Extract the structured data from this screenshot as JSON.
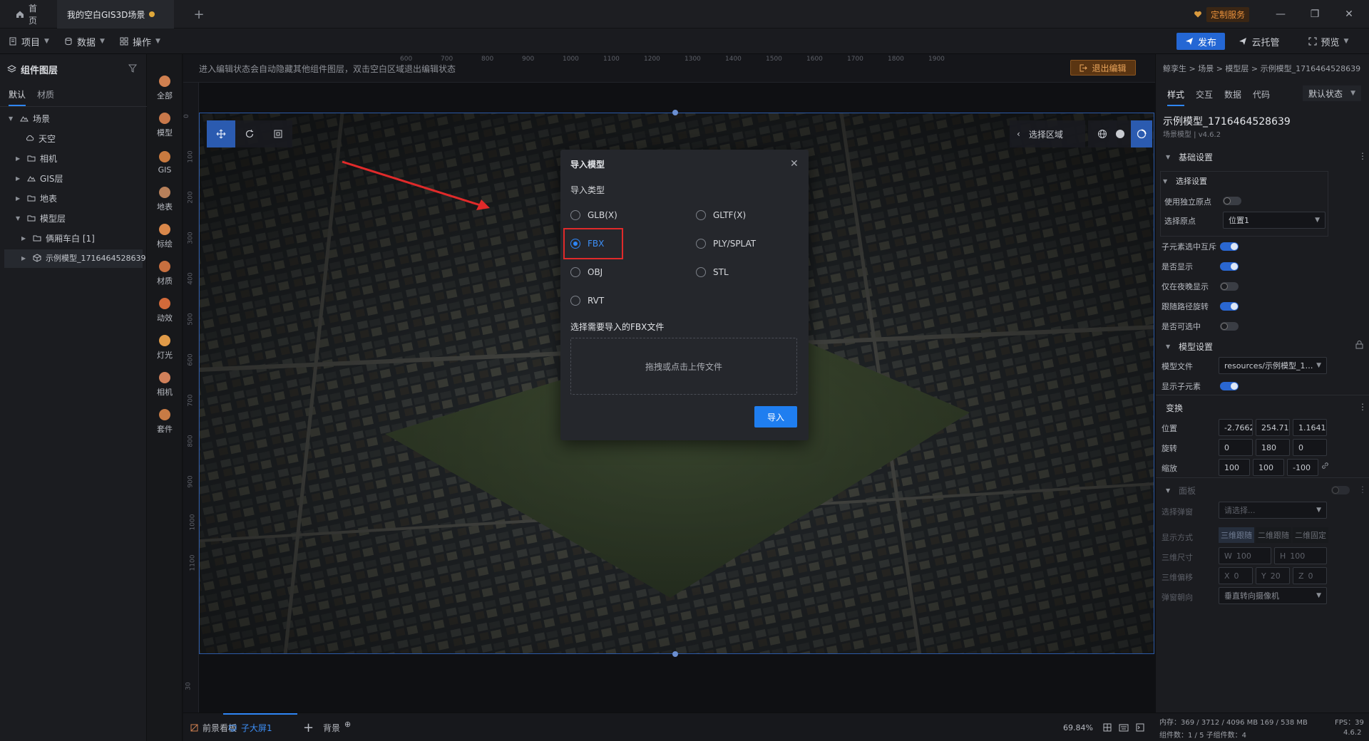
{
  "tabs": [
    {
      "label": "首页"
    },
    {
      "label": "我的空白GIS3D场景"
    }
  ],
  "titlebar": {
    "custom_service": "定制服务"
  },
  "menubar": {
    "project": "项目",
    "data": "数据",
    "operate": "操作",
    "publish": "发布",
    "cloud_host": "云托管",
    "preview": "预览"
  },
  "left": {
    "title": "组件图层",
    "tabs": [
      "默认",
      "材质"
    ],
    "tree": [
      {
        "label": "场景"
      },
      {
        "label": "天空"
      },
      {
        "label": "相机"
      },
      {
        "label": "GIS层"
      },
      {
        "label": "地表"
      },
      {
        "label": "模型层"
      },
      {
        "label": "俩厢车白 [1]"
      },
      {
        "label": "示例模型_1716464528639"
      }
    ]
  },
  "iconbar": [
    {
      "label": "全部",
      "color": "#d08050"
    },
    {
      "label": "模型",
      "color": "#c8784a"
    },
    {
      "label": "GIS",
      "color": "#c97a3f"
    },
    {
      "label": "地表",
      "color": "#b8805a"
    },
    {
      "label": "标绘",
      "color": "#d9874a"
    },
    {
      "label": "材质",
      "color": "#c76f3f"
    },
    {
      "label": "动效",
      "color": "#d36a3a"
    },
    {
      "label": "灯光",
      "color": "#e09a48"
    },
    {
      "label": "相机",
      "color": "#d0805a"
    },
    {
      "label": "套件",
      "color": "#c77b45"
    }
  ],
  "canvas": {
    "hint": "进入编辑状态会自动隐藏其他组件图层，双击空白区域退出编辑状态",
    "exit_edit": "退出编辑",
    "select_area": "选择区域",
    "ruler_top": [
      "600",
      "700",
      "800",
      "900",
      "1000",
      "1100",
      "1200",
      "1300",
      "1400",
      "1500",
      "1600",
      "1700",
      "1800",
      "1900"
    ],
    "ruler_left": [
      "0",
      "100",
      "200",
      "300",
      "400",
      "500",
      "600",
      "700",
      "800",
      "900",
      "1000",
      "1100",
      "30"
    ]
  },
  "modal": {
    "title": "导入模型",
    "type_label": "导入类型",
    "options": [
      {
        "label": "GLB(X)",
        "selected": false
      },
      {
        "label": "GLTF(X)",
        "selected": false
      },
      {
        "label": "FBX",
        "selected": true
      },
      {
        "label": "PLY/SPLAT",
        "selected": false
      },
      {
        "label": "OBJ",
        "selected": false
      },
      {
        "label": "STL",
        "selected": false
      },
      {
        "label": "RVT",
        "selected": false
      }
    ],
    "file_label": "选择需要导入的FBX文件",
    "upload_hint": "拖拽或点击上传文件",
    "import_btn": "导入"
  },
  "right": {
    "breadcrumb": "鲸孪生 > 场景 > 模型层 > 示例模型_1716464528639",
    "tabs": [
      "样式",
      "交互",
      "数据",
      "代码"
    ],
    "state_select": "默认状态",
    "name": "示例模型_1716464528639",
    "subtitle": "场景模型 | v4.6.2",
    "basic_settings": "基础设置",
    "select_settings": "选择设置",
    "use_independent_origin": "使用独立原点",
    "select_origin": "选择原点",
    "origin_value": "位置1",
    "child_exclusive": "子元素选中互斥",
    "is_visible": "是否显示",
    "night_only": "仅在夜晚显示",
    "follow_path": "跟随路径旋转",
    "selectable": "是否可选中",
    "model_settings": "模型设置",
    "model_file": "模型文件",
    "model_file_value": "resources/示例模型_171646...",
    "show_children": "显示子元素",
    "transform": "变换",
    "position": "位置",
    "position_values": [
      "-2.766297",
      "254.71267",
      "1.16415321"
    ],
    "rotation": "旋转",
    "rotation_values": [
      "0",
      "180",
      "0"
    ],
    "scale": "缩放",
    "scale_values": [
      "100",
      "100",
      "-100"
    ],
    "panel": "面板",
    "select_popup": "选择弹窗",
    "select_placeholder": "请选择...",
    "display_mode": "显示方式",
    "display_modes": [
      "三维跟随",
      "二维跟随",
      "二维固定"
    ],
    "size_3d": "三维尺寸",
    "size_w": "100",
    "size_h": "100",
    "offset_3d": "三维偏移",
    "offset_x": "0",
    "offset_y": "20",
    "offset_z": "0",
    "popup_facing": "弹窗朝向",
    "facing_value": "垂直转向摄像机"
  },
  "bottom": {
    "foreground": "前景看板",
    "child_screen": "子大屏1",
    "background": "背景",
    "zoom": "69.84%"
  },
  "status": {
    "memory": "内存：369 / 3712 / 4096 MB  169 / 538 MB",
    "fps": "FPS：39",
    "components": "组件数：1 / 5  子组件数：4",
    "version": "4.6.2"
  }
}
